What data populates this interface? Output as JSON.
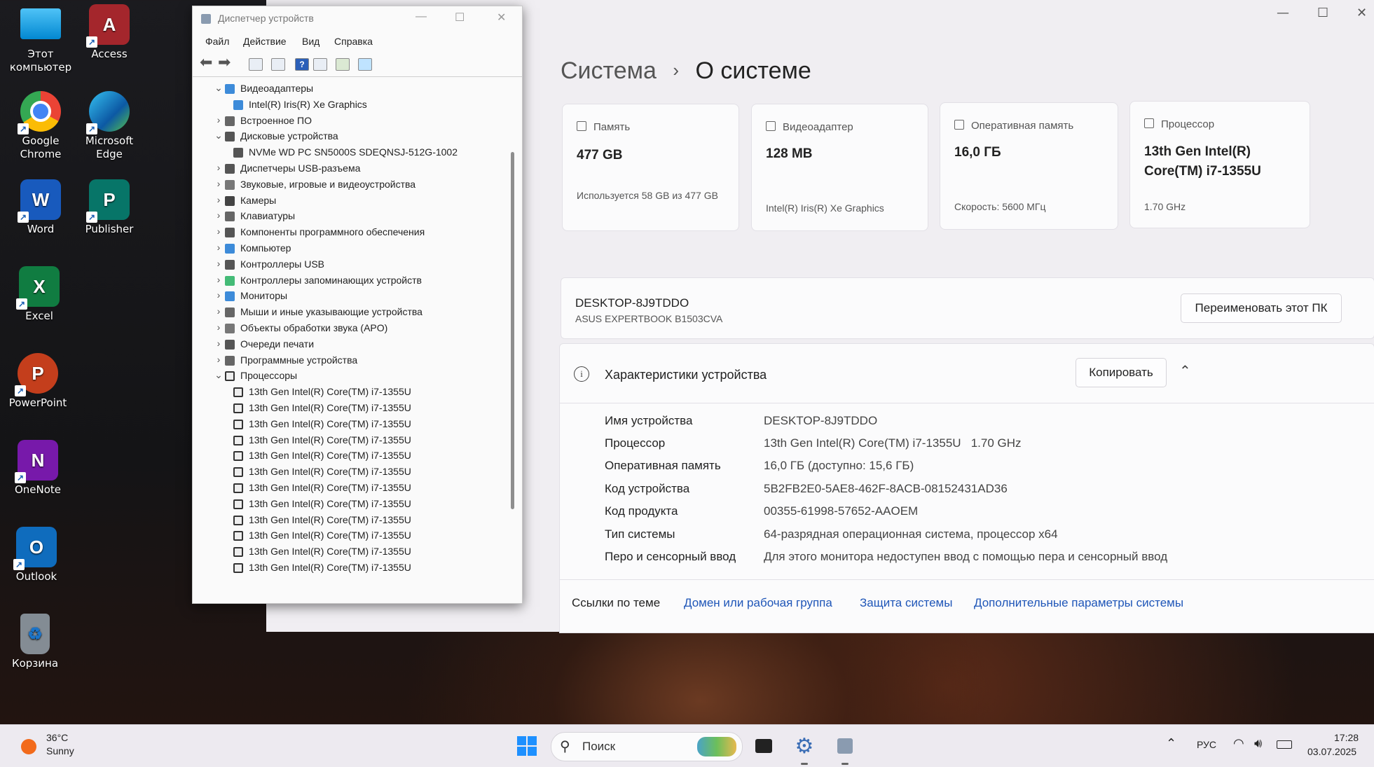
{
  "desktop": {
    "icons": [
      {
        "label": "Этот компьютер"
      },
      {
        "label": "Access"
      },
      {
        "label": "Google Chrome"
      },
      {
        "label": "Microsoft Edge"
      },
      {
        "label": "Word"
      },
      {
        "label": "Publisher"
      },
      {
        "label": "Excel"
      },
      {
        "label": "PowerPoint"
      },
      {
        "label": "OneNote"
      },
      {
        "label": "Outlook"
      },
      {
        "label": "Корзина"
      }
    ]
  },
  "settings": {
    "breadcrumb_parent": "Система",
    "breadcrumb_sep": "›",
    "page_title": "О системе",
    "cards": [
      {
        "caption": "Память",
        "value": "477 GB",
        "sub": "Используется 58 GB из 477 GB",
        "icon": "storage-icon"
      },
      {
        "caption": "Видеоадаптер",
        "value": "128 MB",
        "sub": "Intel(R) Iris(R) Xe Graphics",
        "icon": "gpu-icon"
      },
      {
        "caption": "Оперативная память",
        "value": "16,0 ГБ",
        "sub": "Скорость: 5600 МГц",
        "icon": "ram-icon"
      },
      {
        "caption": "Процессор",
        "value": "13th Gen Intel(R) Core(TM) i7-1355U",
        "sub": "1.70 GHz",
        "icon": "cpu-icon"
      }
    ],
    "device": {
      "name": "DESKTOP-8J9TDDO",
      "model": "ASUS EXPERTBOOK B1503CVA",
      "rename_button": "Переименовать этот ПК"
    },
    "specs": {
      "title": "Характеристики устройства",
      "copy_button": "Копировать",
      "rows": [
        {
          "key": "Имя устройства",
          "value": "DESKTOP-8J9TDDO"
        },
        {
          "key": "Процессор",
          "value": "13th Gen Intel(R) Core(TM) i7-1355U   1.70 GHz"
        },
        {
          "key": "Оперативная память",
          "value": "16,0 ГБ (доступно: 15,6 ГБ)"
        },
        {
          "key": "Код устройства",
          "value": "5B2FB2E0-5AE8-462F-8ACB-08152431AD36"
        },
        {
          "key": "Код продукта",
          "value": "00355-61998-57652-AAOEM"
        },
        {
          "key": "Тип системы",
          "value": "64-разрядная операционная система, процессор x64"
        },
        {
          "key": "Перо и сенсорный ввод",
          "value": "Для этого монитора недоступен ввод с помощью пера и сенсорный ввод"
        }
      ]
    },
    "related": {
      "label": "Ссылки по теме",
      "links": [
        "Домен или рабочая группа",
        "Защита системы",
        "Дополнительные параметры системы"
      ]
    }
  },
  "device_manager": {
    "title": "Диспетчер устройств",
    "menu": [
      "Файл",
      "Действие",
      "Вид",
      "Справка"
    ],
    "tree": [
      {
        "label": "Видеоадаптеры",
        "level": 0,
        "expanded": true,
        "icon": "monitor"
      },
      {
        "label": "Intel(R) Iris(R) Xe Graphics",
        "level": 1,
        "icon": "monitor"
      },
      {
        "label": "Встроенное ПО",
        "level": 0,
        "expanded": false,
        "icon": "chip"
      },
      {
        "label": "Дисковые устройства",
        "level": 0,
        "expanded": true,
        "icon": "disk"
      },
      {
        "label": "NVMe WD PC SN5000S SDEQNSJ-512G-1002",
        "level": 1,
        "icon": "disk"
      },
      {
        "label": "Диспетчеры USB-разъема",
        "level": 0,
        "expanded": false,
        "icon": "usb"
      },
      {
        "label": "Звуковые, игровые и видеоустройства",
        "level": 0,
        "expanded": false,
        "icon": "speaker"
      },
      {
        "label": "Камеры",
        "level": 0,
        "expanded": false,
        "icon": "camera"
      },
      {
        "label": "Клавиатуры",
        "level": 0,
        "expanded": false,
        "icon": "keyboard"
      },
      {
        "label": "Компоненты программного обеспечения",
        "level": 0,
        "expanded": false,
        "icon": "component"
      },
      {
        "label": "Компьютер",
        "level": 0,
        "expanded": false,
        "icon": "monitor"
      },
      {
        "label": "Контроллеры USB",
        "level": 0,
        "expanded": false,
        "icon": "usb"
      },
      {
        "label": "Контроллеры запоминающих устройств",
        "level": 0,
        "expanded": false,
        "icon": "storage"
      },
      {
        "label": "Мониторы",
        "level": 0,
        "expanded": false,
        "icon": "monitor"
      },
      {
        "label": "Мыши и иные указывающие устройства",
        "level": 0,
        "expanded": false,
        "icon": "mouse"
      },
      {
        "label": "Объекты обработки звука (APO)",
        "level": 0,
        "expanded": false,
        "icon": "speaker"
      },
      {
        "label": "Очереди печати",
        "level": 0,
        "expanded": false,
        "icon": "printer"
      },
      {
        "label": "Программные устройства",
        "level": 0,
        "expanded": false,
        "icon": "chip"
      },
      {
        "label": "Процессоры",
        "level": 0,
        "expanded": true,
        "icon": "cpu"
      },
      {
        "label": "13th Gen Intel(R) Core(TM) i7-1355U",
        "level": 1,
        "icon": "cpu"
      },
      {
        "label": "13th Gen Intel(R) Core(TM) i7-1355U",
        "level": 1,
        "icon": "cpu"
      },
      {
        "label": "13th Gen Intel(R) Core(TM) i7-1355U",
        "level": 1,
        "icon": "cpu"
      },
      {
        "label": "13th Gen Intel(R) Core(TM) i7-1355U",
        "level": 1,
        "icon": "cpu"
      },
      {
        "label": "13th Gen Intel(R) Core(TM) i7-1355U",
        "level": 1,
        "icon": "cpu"
      },
      {
        "label": "13th Gen Intel(R) Core(TM) i7-1355U",
        "level": 1,
        "icon": "cpu"
      },
      {
        "label": "13th Gen Intel(R) Core(TM) i7-1355U",
        "level": 1,
        "icon": "cpu"
      },
      {
        "label": "13th Gen Intel(R) Core(TM) i7-1355U",
        "level": 1,
        "icon": "cpu"
      },
      {
        "label": "13th Gen Intel(R) Core(TM) i7-1355U",
        "level": 1,
        "icon": "cpu"
      },
      {
        "label": "13th Gen Intel(R) Core(TM) i7-1355U",
        "level": 1,
        "icon": "cpu"
      },
      {
        "label": "13th Gen Intel(R) Core(TM) i7-1355U",
        "level": 1,
        "icon": "cpu"
      },
      {
        "label": "13th Gen Intel(R) Core(TM) i7-1355U",
        "level": 1,
        "icon": "cpu"
      }
    ]
  },
  "taskbar": {
    "weather_temp": "36°C",
    "weather_desc": "Sunny",
    "search_placeholder": "Поиск",
    "language": "РУС",
    "time": "17:28",
    "date": "03.07.2025"
  },
  "colors": {
    "accent": "#1f56b8",
    "settings_bg": "#f0eef2",
    "taskbar_bg": "#edeaf0"
  }
}
